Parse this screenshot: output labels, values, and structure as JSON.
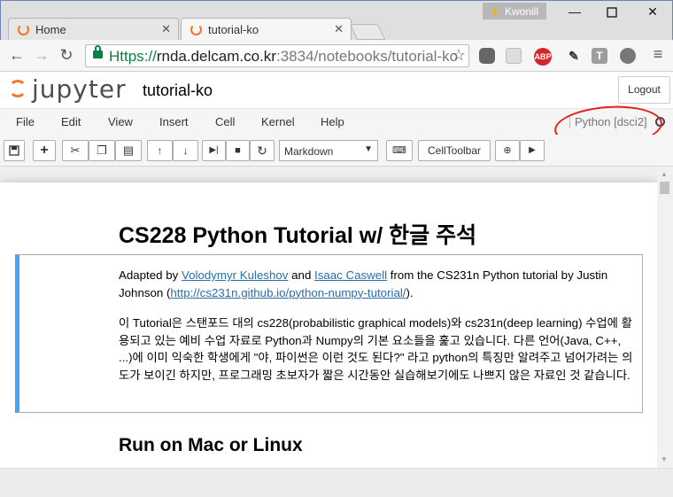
{
  "browser": {
    "tabs": [
      {
        "title": "Home",
        "active": false
      },
      {
        "title": "tutorial-ko",
        "active": true
      }
    ],
    "profile_name": "Kwonill",
    "url": {
      "scheme": "Https://",
      "host": "rnda.delcam.co.kr",
      "path": ":3834/notebooks/tutorial-ko"
    },
    "extensions": [
      "shield-extension",
      "cast-extension",
      "ABP",
      "eyedropper-extension",
      "T",
      "puzzle-extension"
    ]
  },
  "jupyter": {
    "logo_text": "jupyter",
    "notebook_name": "tutorial-ko",
    "logout_label": "Logout",
    "menus": [
      "File",
      "Edit",
      "View",
      "Insert",
      "Cell",
      "Kernel",
      "Help"
    ],
    "kernel_name": "Python [dsci2]",
    "cell_type": "Markdown",
    "celltoolbar_label": "CellToolbar"
  },
  "content": {
    "title": "CS228 Python Tutorial w/ 한글 주석",
    "intro": {
      "t1": "Adapted by ",
      "link1": "Volodymyr Kuleshov",
      "t2": " and ",
      "link2": "Isaac Caswell",
      "t3": " from the CS231n Python tutorial by Justin Johnson (",
      "link3": "http://cs231n.github.io/python-numpy-tutorial/",
      "t4": ")."
    },
    "korean_paragraph": "이 Tutorial은 스탠포드 대의 cs228(probabilistic graphical models)와 cs231n(deep learning) 수업에 활용되고 있는 예비 수업 자료로 Python과 Numpy의 기본 요소들을 훑고 있습니다. 다른 언어(Java, C++, ...)에 이미 익숙한 학생에게 \"야, 파이썬은 이런 것도 된다?\" 라고 python의 특징만 알려주고 넘어가려는 의도가 보이긴 하지만, 프로그래밍 초보자가 짧은 시간동안 실습해보기에도 나쁘지 않은 자료인 것 같습니다.",
    "section_heading": "Run on Mac or Linux"
  },
  "colors": {
    "jupyter_orange": "#f37726",
    "link_blue": "#296eaa",
    "cell_selected_border": "#42a5f5",
    "annotation_red": "#e02020"
  }
}
